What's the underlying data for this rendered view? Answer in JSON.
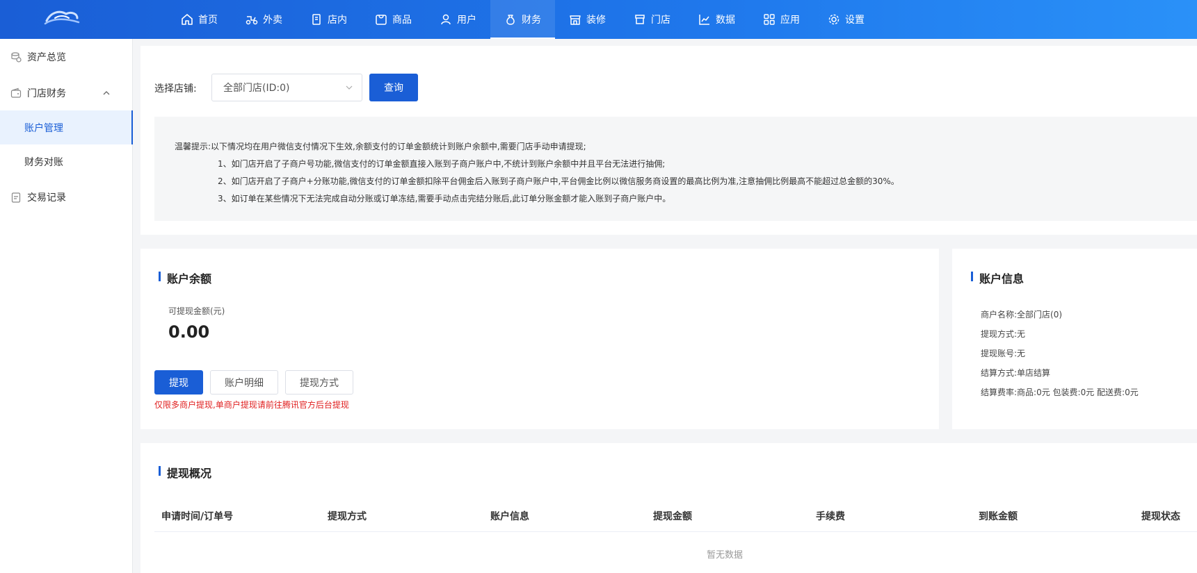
{
  "nav": {
    "items": [
      {
        "label": "首页",
        "icon": "home-icon"
      },
      {
        "label": "外卖",
        "icon": "scooter-icon"
      },
      {
        "label": "店内",
        "icon": "dine-in-icon"
      },
      {
        "label": "商品",
        "icon": "goods-icon"
      },
      {
        "label": "用户",
        "icon": "user-icon"
      },
      {
        "label": "财务",
        "icon": "money-bag-icon",
        "active": true
      },
      {
        "label": "装修",
        "icon": "storefront-icon"
      },
      {
        "label": "门店",
        "icon": "store-icon"
      },
      {
        "label": "数据",
        "icon": "line-chart-icon"
      },
      {
        "label": "应用",
        "icon": "apps-grid-icon"
      },
      {
        "label": "设置",
        "icon": "gear-icon"
      }
    ]
  },
  "sidebar": {
    "asset_overview": "资产总览",
    "store_finance": "门店财务",
    "account_mgmt": "账户管理",
    "reconciliation": "财务对账",
    "transactions": "交易记录"
  },
  "filter": {
    "label": "选择店铺:",
    "selected": "全部门店(ID:0)",
    "query_button": "查询"
  },
  "tips": {
    "line0": "温馨提示:以下情况均在用户微信支付情况下生效,余额支付的订单金额统计到账户余额中,需要门店手动申请提现;",
    "line1": "1、如门店开启了子商户号功能,微信支付的订单金额直接入账到子商户账户中,不统计到账户余额中并且平台无法进行抽佣;",
    "line2": "2、如门店开启了子商户+分账功能,微信支付的订单金额扣除平台佣金后入账到子商户账户中,平台佣金比例以微信服务商设置的最高比例为准,注意抽佣比例最高不能超过总金额的30%。",
    "line3": "3、如订单在某些情况下无法完成自动分账或订单冻结,需要手动点击完结分账后,此订单分账金额才能入账到子商户账户中。"
  },
  "balance": {
    "title": "账户余额",
    "available_label": "可提现金额(元)",
    "amount": "0.00",
    "withdraw_button": "提现",
    "detail_button": "账户明细",
    "method_button": "提现方式",
    "warning": "仅限多商户提现,单商户提现请前往腾讯官方后台提现"
  },
  "account_info": {
    "title": "账户信息",
    "merchant_name": "商户名称:全部门店(0)",
    "withdraw_method": "提现方式:无",
    "withdraw_account": "提现账号:无",
    "settle_method": "结算方式:单店结算",
    "settle_rate": "结算费率:商品:0元 包装费:0元 配送费:0元"
  },
  "withdraw_overview": {
    "title": "提现概况",
    "columns": [
      "申请时间/订单号",
      "提现方式",
      "账户信息",
      "提现金额",
      "手续费",
      "到账金额",
      "提现状态"
    ],
    "empty_text": "暂无数据"
  },
  "colors": {
    "primary": "#1a5ed6",
    "warning_text": "#e02020"
  }
}
